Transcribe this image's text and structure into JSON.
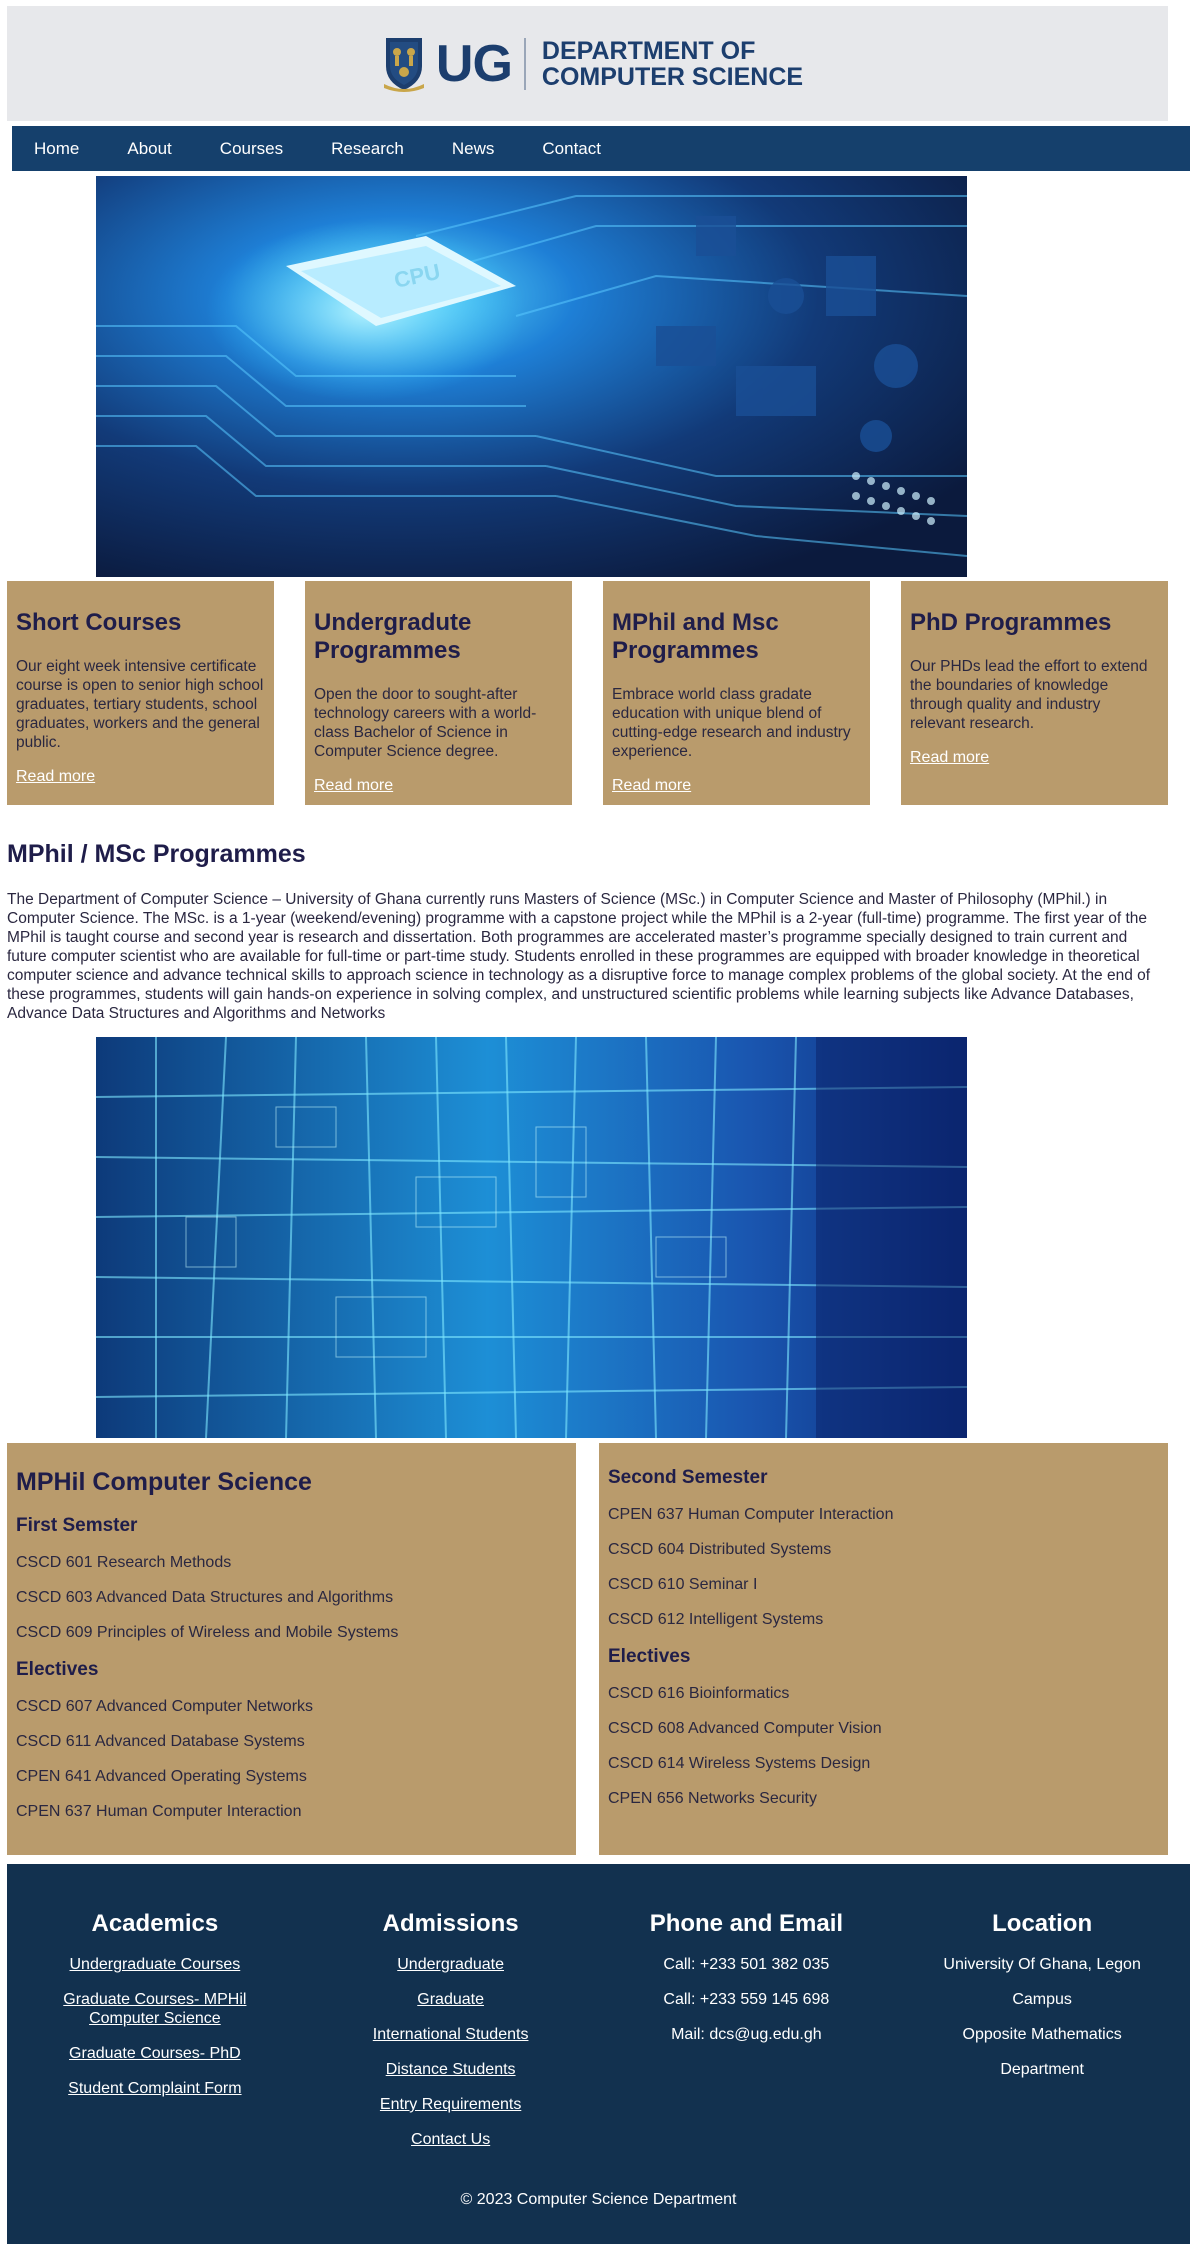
{
  "header": {
    "logo_text": "UG",
    "dept_line1": "DEPARTMENT OF",
    "dept_line2": "COMPUTER SCIENCE"
  },
  "nav": {
    "items": [
      "Home",
      "About",
      "Courses",
      "Research",
      "News",
      "Contact"
    ]
  },
  "images": {
    "hero1": "cpu-circuit-board-image",
    "hero2": "digital-data-grid-image"
  },
  "cards": [
    {
      "title": "Short Courses",
      "text": "Our eight week intensive certificate course is open to senior high school graduates, tertiary students, school graduates, workers and the general public.",
      "link": "Read more"
    },
    {
      "title": "Undergradute Programmes",
      "text": "Open the door to sought-after technology careers with a world-class Bachelor of Science in Computer Science degree.",
      "link": "Read more"
    },
    {
      "title": "MPhil and Msc Programmes",
      "text": "Embrace world class gradate education with unique blend of cutting-edge research and industry experience.",
      "link": "Read more"
    },
    {
      "title": "PhD Programmes",
      "text": "Our PHDs lead the effort to extend the boundaries of knowledge through quality and industry relevant research.",
      "link": "Read more"
    }
  ],
  "section": {
    "title": "MPhil / MSc Programmes",
    "body": "The Department of Computer Science – University of Ghana currently runs Masters of Science (MSc.) in Computer Science and Master of Philosophy (MPhil.) in Computer Science. The MSc. is a 1-year (weekend/evening) programme with a capstone project while the MPhil is a 2-year (full-time) programme. The first year of the MPhil is taught course and second year is research and dissertation. Both programmes are accelerated master’s programme specially designed to train current and future computer scientist who are available for full-time or part-time study. Students enrolled in these programmes are equipped with broader knowledge in theoretical computer science and advance technical skills to approach science in technology as a disruptive force to manage complex problems of the global society. At the end of these programmes, students will gain hands-on experience in solving complex, and unstructured scientific problems while learning subjects like Advance Databases, Advance Data Structures and Algorithms and Networks"
  },
  "courses": {
    "title": "MPHil Computer Science",
    "first_semester": {
      "heading": "First Semster",
      "items": [
        "CSCD 601 Research Methods",
        "CSCD 603 Advanced Data Structures and Algorithms",
        "CSCD 609 Principles of Wireless and Mobile Systems"
      ]
    },
    "first_electives": {
      "heading": "Electives",
      "items": [
        "CSCD 607 Advanced Computer Networks",
        "CSCD 611 Advanced Database Systems",
        "CPEN 641 Advanced Operating Systems",
        "CPEN 637 Human Computer Interaction"
      ]
    },
    "second_semester": {
      "heading": "Second Semester",
      "items": [
        "CPEN 637 Human Computer Interaction",
        "CSCD 604 Distributed Systems",
        "CSCD 610 Seminar I",
        "CSCD 612 Intelligent Systems"
      ]
    },
    "second_electives": {
      "heading": "Electives",
      "items": [
        "CSCD 616 Bioinformatics",
        "CSCD 608 Advanced Computer Vision",
        "CSCD 614 Wireless Systems Design",
        "CPEN 656 Networks Security"
      ]
    }
  },
  "footer": {
    "academics": {
      "heading": "Academics",
      "links": [
        "Undergraduate Courses",
        "Graduate Courses- MPHil Computer Science",
        "Graduate Courses- PhD",
        "Student Complaint Form"
      ]
    },
    "admissions": {
      "heading": "Admissions",
      "links": [
        "Undergraduate",
        "Graduate",
        "International Students",
        "Distance Students",
        "Entry Requirements",
        "Contact Us"
      ]
    },
    "contact": {
      "heading": "Phone and Email",
      "lines": [
        "Call: +233 501 382 035",
        "Call: +233 559 145 698",
        "Mail: dcs@ug.edu.gh"
      ]
    },
    "location": {
      "heading": "Location",
      "lines": [
        "University Of Ghana, Legon",
        "Campus",
        "Opposite Mathematics",
        "Department"
      ]
    },
    "copyright": "© 2023 Computer Science Department"
  },
  "colors": {
    "nav_bg": "#15406c",
    "card_bg": "#b99b6c",
    "footer_bg": "#12314f",
    "header_bg": "#e7e8eb",
    "heading_text": "#1f1d4a"
  }
}
